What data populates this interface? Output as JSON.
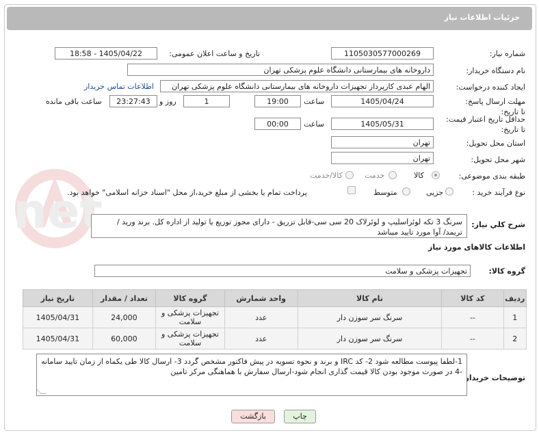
{
  "header": {
    "title": "جزئیات اطلاعات نیاز"
  },
  "labels": {
    "need_number": "شماره نیاز:",
    "announce_datetime": "تاریخ و ساعت اعلان عمومی:",
    "buyer_org": "نام دستگاه خریدار:",
    "requester": "ایجاد کننده درخواست:",
    "reply_deadline": "مهلت ارسال پاسخ: تا تاریخ:",
    "price_validity": "حداقل تاریخ اعتبار قیمت: تا تاریخ:",
    "hour": "ساعت",
    "day_and": "روز و",
    "hours_remaining": "ساعت باقی مانده",
    "province": "استان محل تحویل:",
    "city": "شهر محل تحویل:",
    "category": "طبقه بندی موضوعی:",
    "purchase_process": "نوع فرآیند خرید :",
    "general_desc": "شرح کلي نياز:",
    "goods_info": "اطلاعات کالاهای مورد نیاز",
    "goods_group": "گروه کالا:",
    "buyer_notes": "توضیحات خریدار:"
  },
  "values": {
    "need_number": "1105030577000269",
    "announce_datetime": "1405/04/22 - 18:58",
    "buyer_org": "داروخانه های بیمارستانی دانشگاه علوم پزشکی تهران",
    "requester": "الهام عبدی کارپرداز تجهیزات داروخانه های بیمارستانی دانشگاه علوم پزشکی تهران",
    "contact_link": "اطلاعات تماس خریدار",
    "reply_date": "1405/04/24",
    "reply_time": "19:00",
    "days": "1",
    "remaining_time": "23:27:43",
    "validity_date": "1405/05/31",
    "validity_time": "00:00",
    "province": "تهران",
    "city": "تهران",
    "goods_group": "تجهیزات پزشکی و سلامت"
  },
  "category_options": [
    "کالا",
    "خدمت",
    "کالا/خدمت"
  ],
  "process_options": [
    "جزیی",
    "متوسط"
  ],
  "payment_note": "پرداخت تمام یا بخشی از مبلغ خرید،از محل \"اسناد خزانه اسلامی\" خواهد بود.",
  "general_desc_text": "سرنگ 3 تکه لوئراسلیپ و لوئرلاک 20 سی سی-قابل تزریق - دارای مجوز توزیع یا تولید از اداره کل. برند ورید / تریمد/ آوا مورد تایید میباشد",
  "table": {
    "headers": [
      "ردیف",
      "کد کالا",
      "نام کالا",
      "واحد شمارش",
      "گروه کالا",
      "تعداد / مقدار",
      "تاریخ نیاز"
    ],
    "rows": [
      [
        "1",
        "--",
        "سرنگ سر سوزن دار",
        "عدد",
        "تجهیزات پزشکی و سلامت",
        "24,000",
        "1405/04/31"
      ],
      [
        "2",
        "--",
        "سرنگ سر سوزن دار",
        "عدد",
        "تجهیزات پزشکی و سلامت",
        "60,000",
        "1405/04/31"
      ]
    ]
  },
  "buyer_notes_text": "1-لطفا پیوست مطالعه شود 2- کد IRC و برند و نحوه تسویه در پیش فاکتور مشخص گردد 3- ارسال کالا طی یکماه از زمان تایید سامانه  -4 در صورت موجود بودن کالا قیمت گذاری انجام شود-ارسال سفارش با هماهنگی مرکز تامین",
  "buttons": {
    "print": "چاپ",
    "back": "بازگشت"
  },
  "watermark": "AriaTender.net",
  "colors": {
    "header_bg": "#b9b9b9",
    "link": "#1b4e9c",
    "back_button_bg": "#f9dede",
    "print_button_bg": "#e4f3df"
  }
}
